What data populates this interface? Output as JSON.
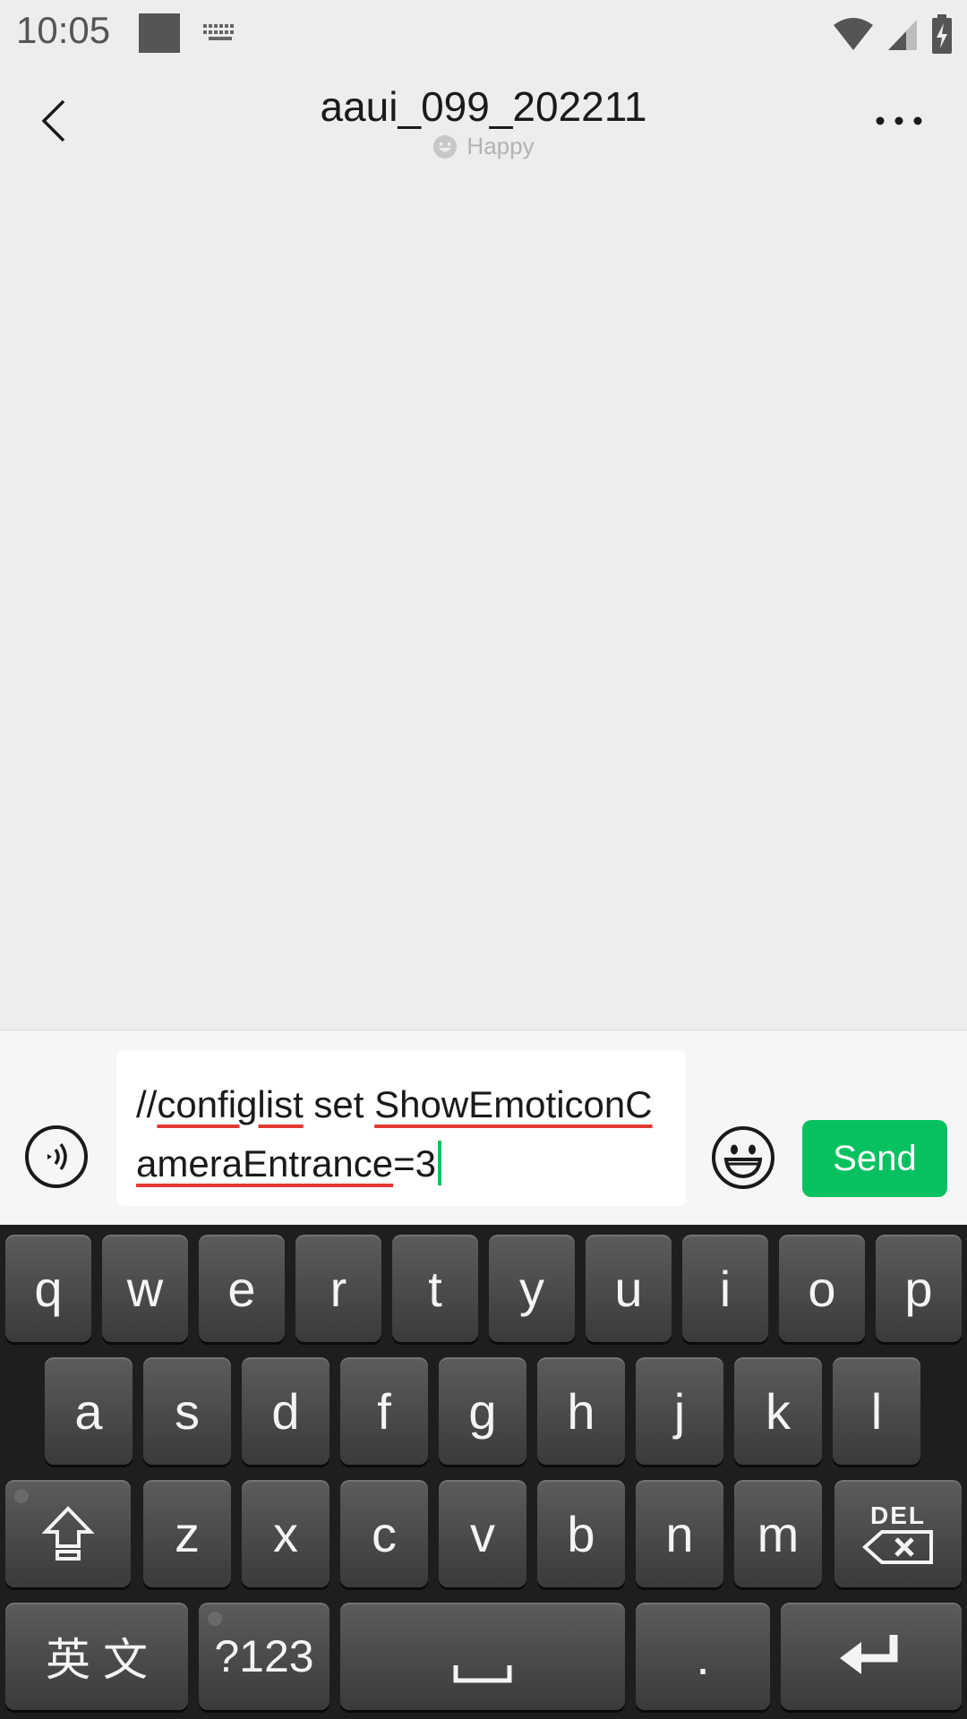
{
  "status_bar": {
    "time": "10:05",
    "icons": [
      "notification-square-icon",
      "keyboard-icon",
      "wifi-icon",
      "signal-icon",
      "battery-charging-icon"
    ]
  },
  "header": {
    "title": "aaui_099_202211",
    "status_text": "Happy",
    "status_icon": "happy-face-icon",
    "back_icon": "chevron-left-icon",
    "more_icon": "more-dots-icon"
  },
  "input_bar": {
    "voice_icon": "voice-icon",
    "text_parts": [
      "//",
      "configlist",
      " set ",
      "ShowEmoticonCameraEntrance",
      "=3"
    ],
    "emoji_icon": "emoji-icon",
    "send_label": "Send",
    "accent_color": "#07c160",
    "spellcheck_color": "#e53935"
  },
  "keyboard": {
    "row1": [
      "q",
      "w",
      "e",
      "r",
      "t",
      "y",
      "u",
      "i",
      "o",
      "p"
    ],
    "row2": [
      "a",
      "s",
      "d",
      "f",
      "g",
      "h",
      "j",
      "k",
      "l"
    ],
    "row3": [
      "z",
      "x",
      "c",
      "v",
      "b",
      "n",
      "m"
    ],
    "del_label": "DEL",
    "lang_label": "英 文",
    "symbols_label": "?123",
    "period_label": "."
  }
}
